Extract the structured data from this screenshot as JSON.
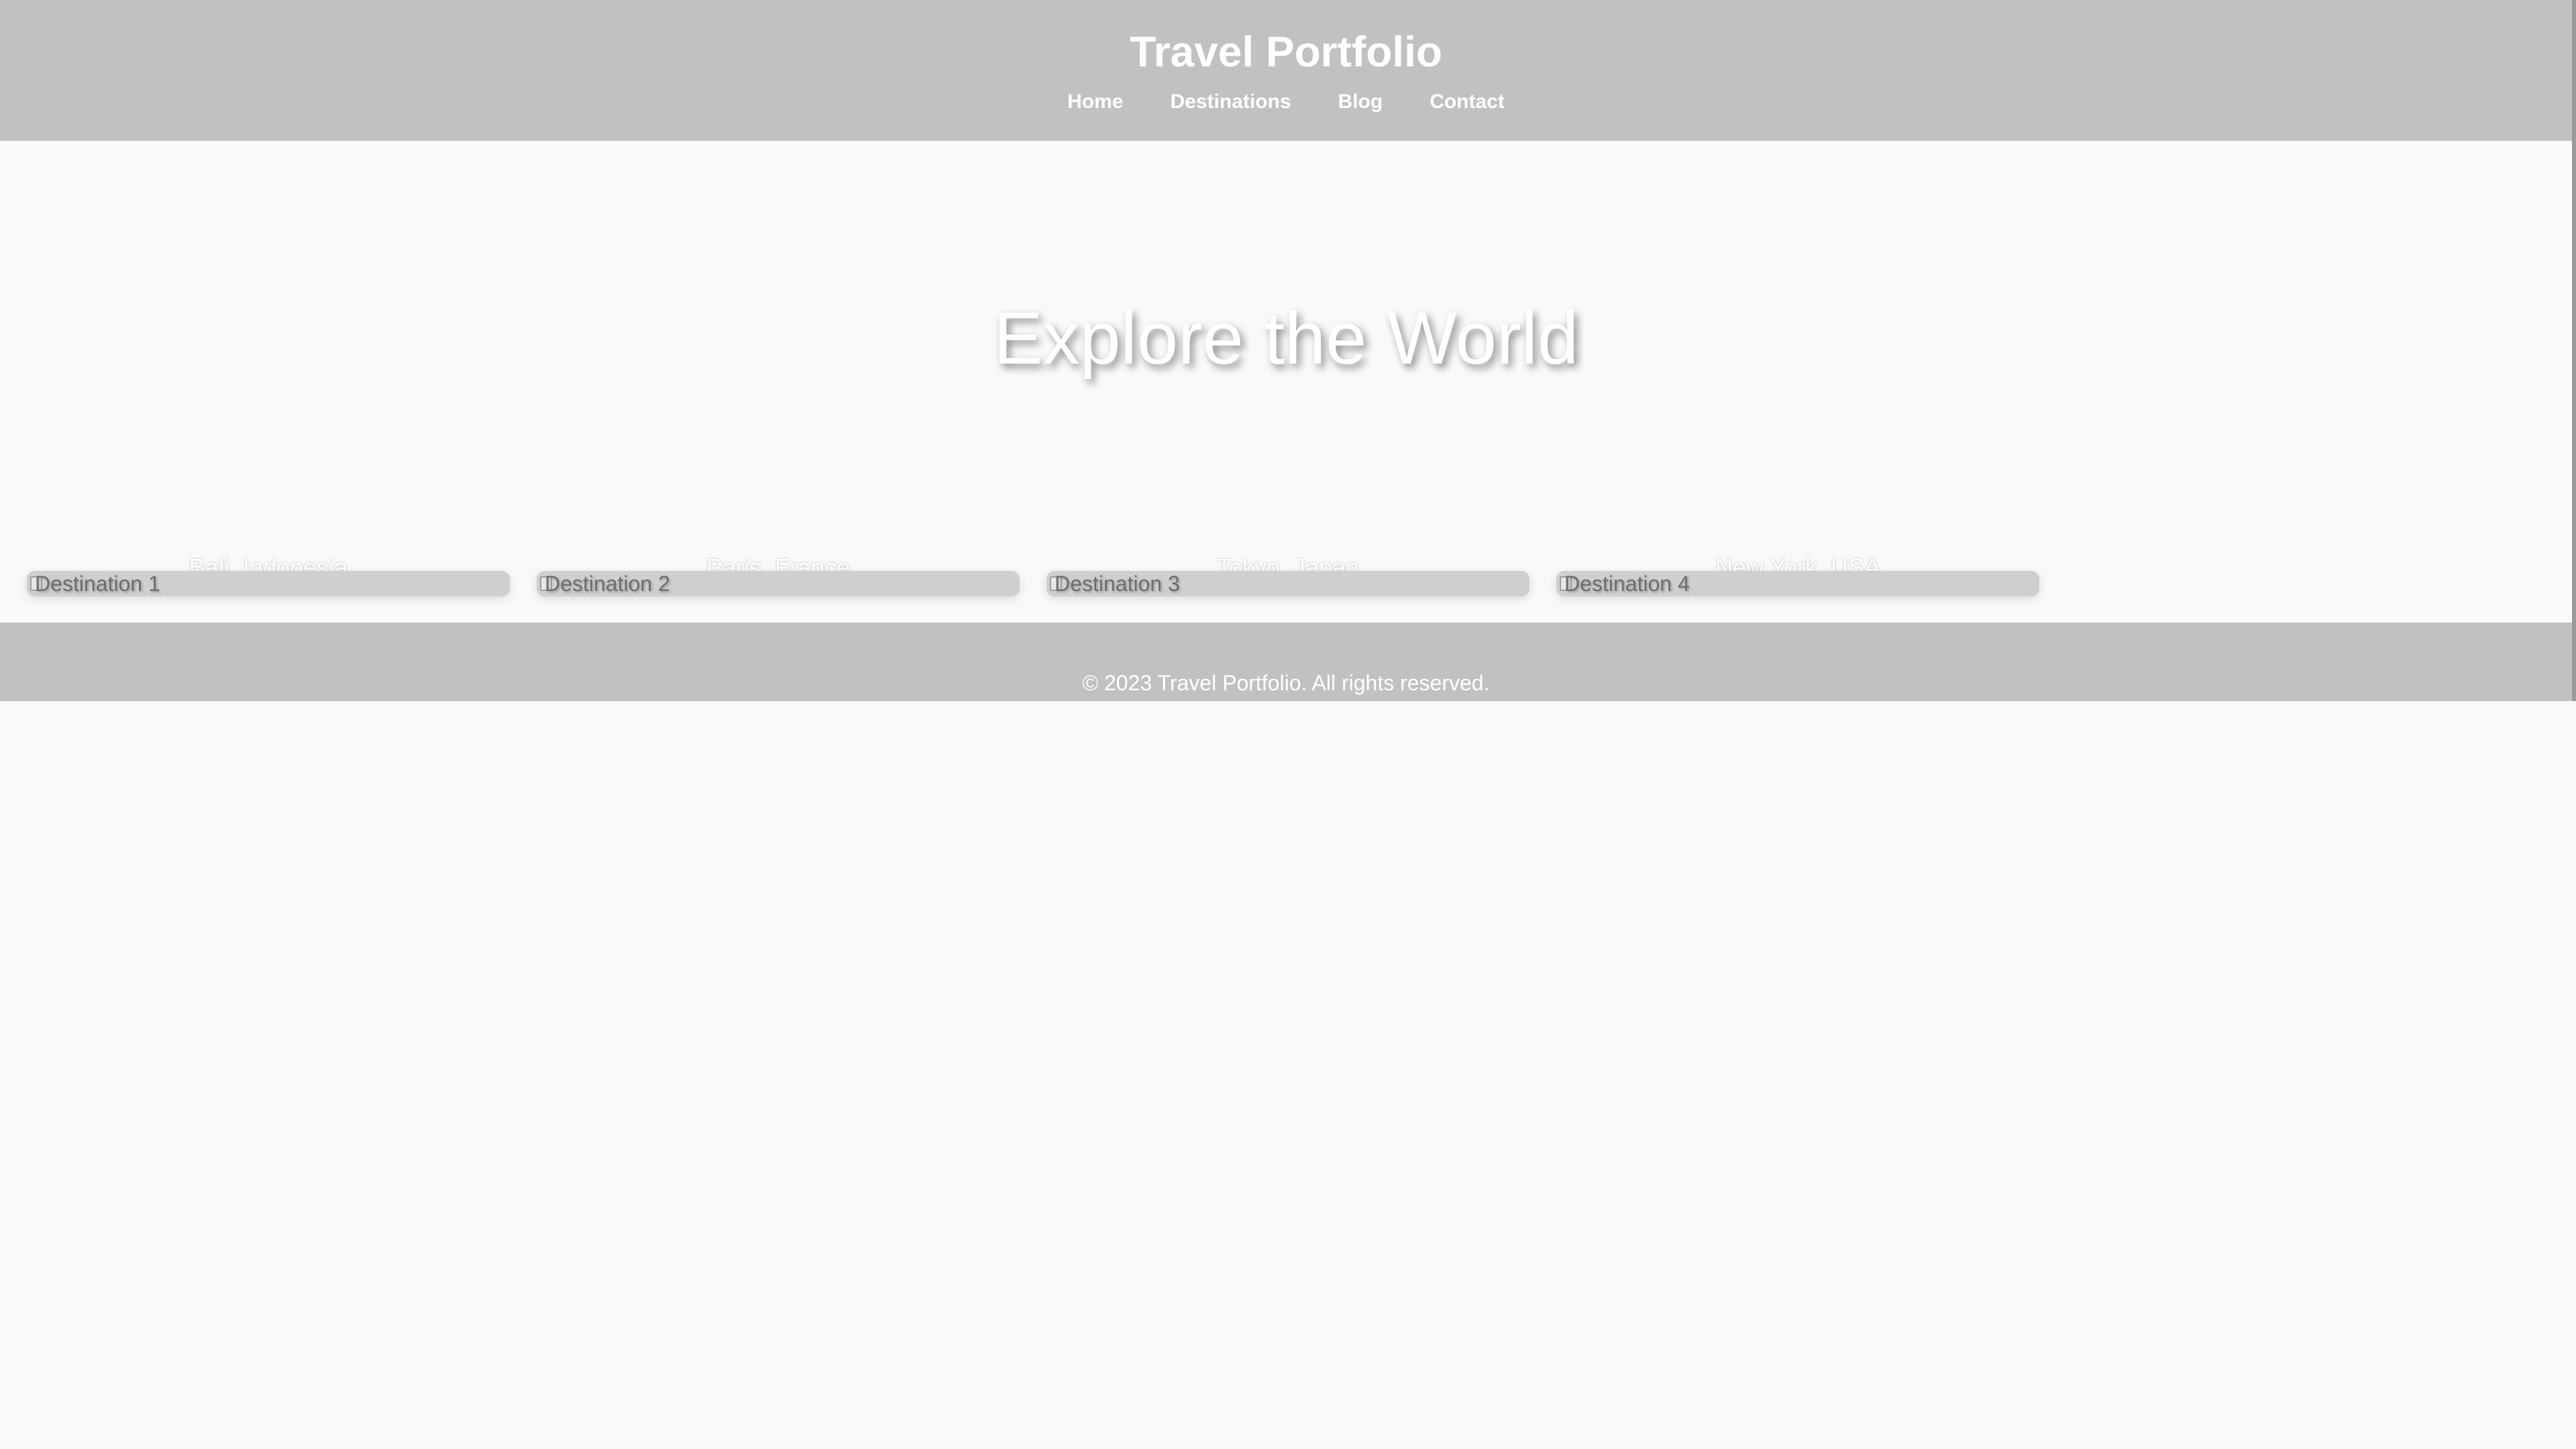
{
  "header": {
    "title": "Travel Portfolio",
    "nav": [
      {
        "label": "Home"
      },
      {
        "label": "Destinations"
      },
      {
        "label": "Blog"
      },
      {
        "label": "Contact"
      }
    ]
  },
  "hero": {
    "title": "Explore the World"
  },
  "destinations": [
    {
      "name": "Bali, Indonesia",
      "image_alt": "Destination 1"
    },
    {
      "name": "Paris, France",
      "image_alt": "Destination 2"
    },
    {
      "name": "Tokyo, Japan",
      "image_alt": "Destination 3"
    },
    {
      "name": "New York, USA",
      "image_alt": "Destination 4"
    }
  ],
  "footer": {
    "text": "© 2023 Travel Portfolio. All rights reserved."
  },
  "colors": {
    "header_bg": "#c1c1c1",
    "page_bg": "#f9f9f9",
    "text": "#ffffff"
  }
}
